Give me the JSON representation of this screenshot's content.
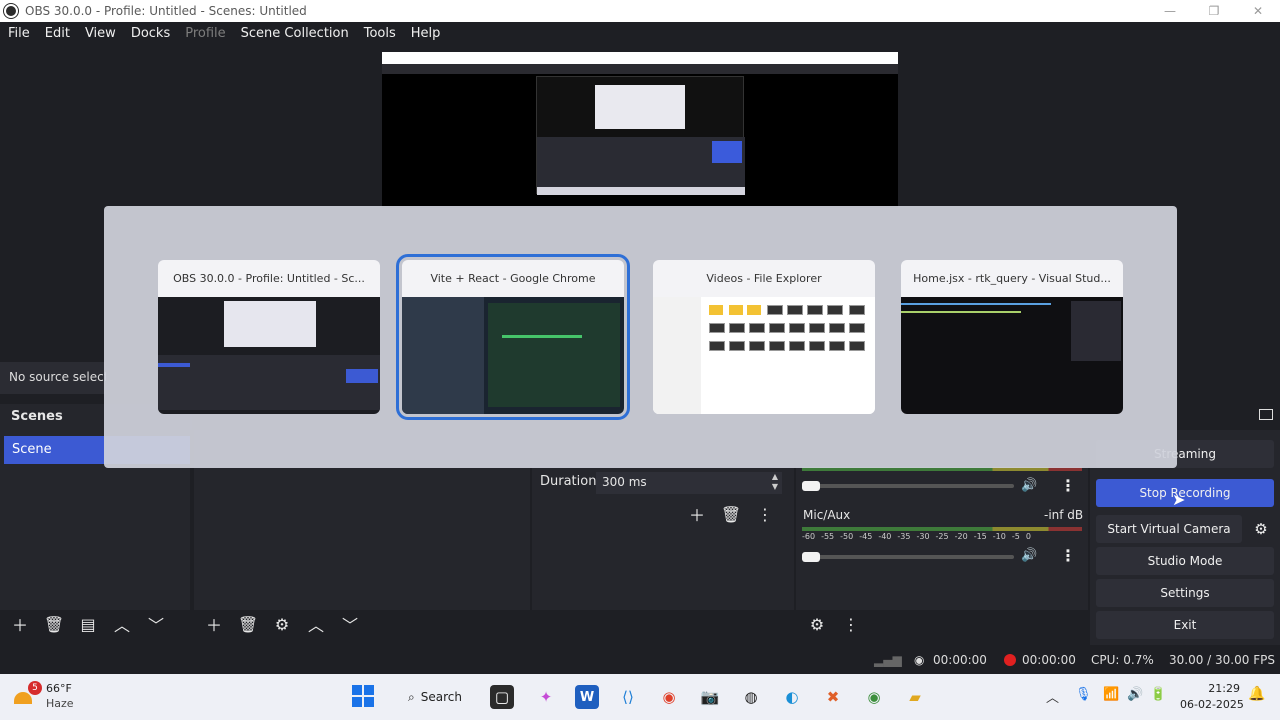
{
  "window": {
    "title": "OBS 30.0.0 - Profile: Untitled - Scenes: Untitled",
    "minimize": "—",
    "maximize": "❐",
    "close": "✕"
  },
  "menu": [
    "File",
    "Edit",
    "View",
    "Docks",
    "Profile",
    "Scene Collection",
    "Tools",
    "Help"
  ],
  "sources": {
    "no_source_label": "No source selected"
  },
  "scenes": {
    "header": "Scenes",
    "items": [
      "Scene"
    ]
  },
  "transitions": {
    "duration_label": "Duration",
    "duration_value": "300 ms"
  },
  "mixer": {
    "scale": [
      "-60",
      "-55",
      "-50",
      "-45",
      "-40",
      "-35",
      "-30",
      "-25",
      "-20",
      "-15",
      "-10",
      "-5",
      "0"
    ],
    "channel_name": "Mic/Aux",
    "channel_level": "-inf dB"
  },
  "controls": {
    "streaming": "Streaming",
    "stop_recording": "Stop Recording",
    "start_virtual_camera": "Start Virtual Camera",
    "studio_mode": "Studio Mode",
    "settings": "Settings",
    "exit": "Exit"
  },
  "status": {
    "stream_time": "00:00:00",
    "rec_time": "00:00:00",
    "cpu": "CPU: 0.7%",
    "fps": "30.00 / 30.00 FPS"
  },
  "alt_tab": {
    "windows": [
      {
        "title": "OBS 30.0.0 - Profile: Untitled - Sc...",
        "selected": false
      },
      {
        "title": "Vite + React - Google Chrome",
        "selected": true
      },
      {
        "title": "Videos - File Explorer",
        "selected": false
      },
      {
        "title": "Home.jsx - rtk_query - Visual Stud...",
        "selected": false
      }
    ]
  },
  "taskbar": {
    "weather_badge": "5",
    "weather_temp": "66°F",
    "weather_condition": "Haze",
    "search_label": "Search",
    "time": "21:29",
    "date": "06-02-2025"
  },
  "colors": {
    "accent": "#3c5ad3",
    "selection_outline": "#2e6fd6",
    "recording": "#e02020"
  }
}
